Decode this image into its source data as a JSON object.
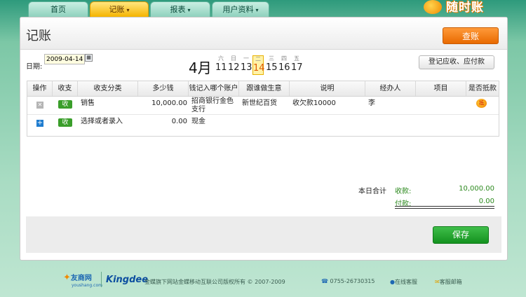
{
  "nav": {
    "tabs": [
      {
        "label": "首页"
      },
      {
        "label": "记账"
      },
      {
        "label": "报表"
      },
      {
        "label": "用户资料"
      }
    ],
    "caret": "▾",
    "brand": "随时账"
  },
  "header": {
    "title": "记账",
    "query_button": "查账"
  },
  "date_bar": {
    "label": "日期:",
    "value": "2009-04-14",
    "month": "4月",
    "days": [
      {
        "weekday": "六",
        "num": "11"
      },
      {
        "weekday": "日",
        "num": "12"
      },
      {
        "weekday": "一",
        "num": "13"
      },
      {
        "weekday": "二",
        "num": "14",
        "selected": true
      },
      {
        "weekday": "三",
        "num": "15"
      },
      {
        "weekday": "四",
        "num": "16"
      },
      {
        "weekday": "五",
        "num": "17"
      }
    ],
    "register_button": "登记应收、应付款"
  },
  "table": {
    "columns": [
      "操作",
      "收支",
      "收支分类",
      "多少钱",
      "钱记入哪个账户",
      "跟谁做生意",
      "说明",
      "经办人",
      "项目",
      "是否抵款"
    ],
    "rows": [
      {
        "action_icon": "delete-icon",
        "type": "收",
        "category": "销售",
        "amount": "10,000.00",
        "account_line1": "招商银行金色",
        "account_line2": "支行",
        "partner": "新世纪百货",
        "note": "收欠款10000",
        "handler": "李",
        "project": "",
        "offset_icon": "offset-icon"
      },
      {
        "action_icon": "add-icon",
        "type": "收",
        "category": "选择或者录入",
        "amount": "0.00",
        "account_line1": "现金",
        "account_line2": "",
        "partner": "",
        "note": "",
        "handler": "",
        "project": ""
      }
    ]
  },
  "totals": {
    "label": "本日合计",
    "income_label": "收款:",
    "income_value": "10,000.00",
    "expense_label": "付款:",
    "expense_value": "0.00"
  },
  "save_button": "保存",
  "footer": {
    "site_logo": "友商网",
    "site_logo_sub": "youshang.com",
    "kingdee": "Kingdee",
    "copyright": "金蝶旗下网站金蝶移动互联公司版权所有 © 2007-2009",
    "phone": "0755-26730315",
    "online_service": "在线客服",
    "email_service": "客服邮箱"
  },
  "colors": {
    "active_tab": "#f5b400",
    "query_button": "#e96a00",
    "save_button": "#14921f",
    "income_text": "#2d8a1f"
  }
}
